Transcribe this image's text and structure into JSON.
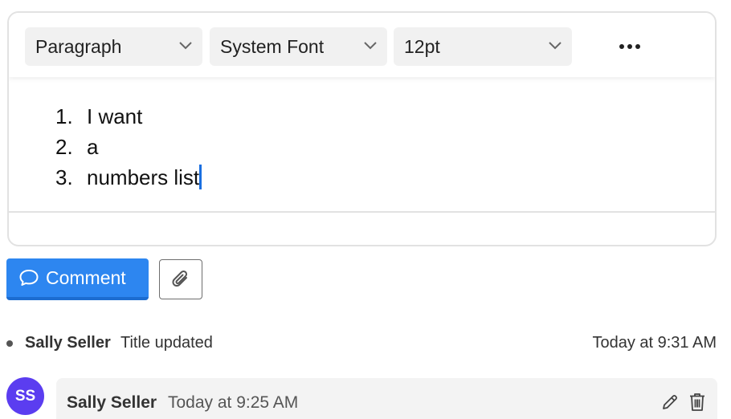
{
  "toolbar": {
    "block_format": "Paragraph",
    "font_family": "System Font",
    "font_size": "12pt",
    "more_icon": "more-horizontal-icon"
  },
  "editor": {
    "list_items": [
      {
        "number": "1.",
        "text": "I want"
      },
      {
        "number": "2.",
        "text": "a"
      },
      {
        "number": "3.",
        "text": "numbers list"
      }
    ]
  },
  "actions": {
    "comment_label": "Comment",
    "comment_icon": "speech-bubble-icon",
    "attach_icon": "paperclip-icon"
  },
  "activity": {
    "user": "Sally Seller",
    "action": "Title updated",
    "time": "Today at 9:31 AM"
  },
  "comment": {
    "avatar_initials": "SS",
    "author": "Sally Seller",
    "time": "Today at 9:25 AM",
    "edit_icon": "pencil-icon",
    "delete_icon": "trash-icon"
  },
  "colors": {
    "primary": "#2d86f0",
    "avatar": "#5b3df0",
    "caret": "#1a6fe0"
  }
}
